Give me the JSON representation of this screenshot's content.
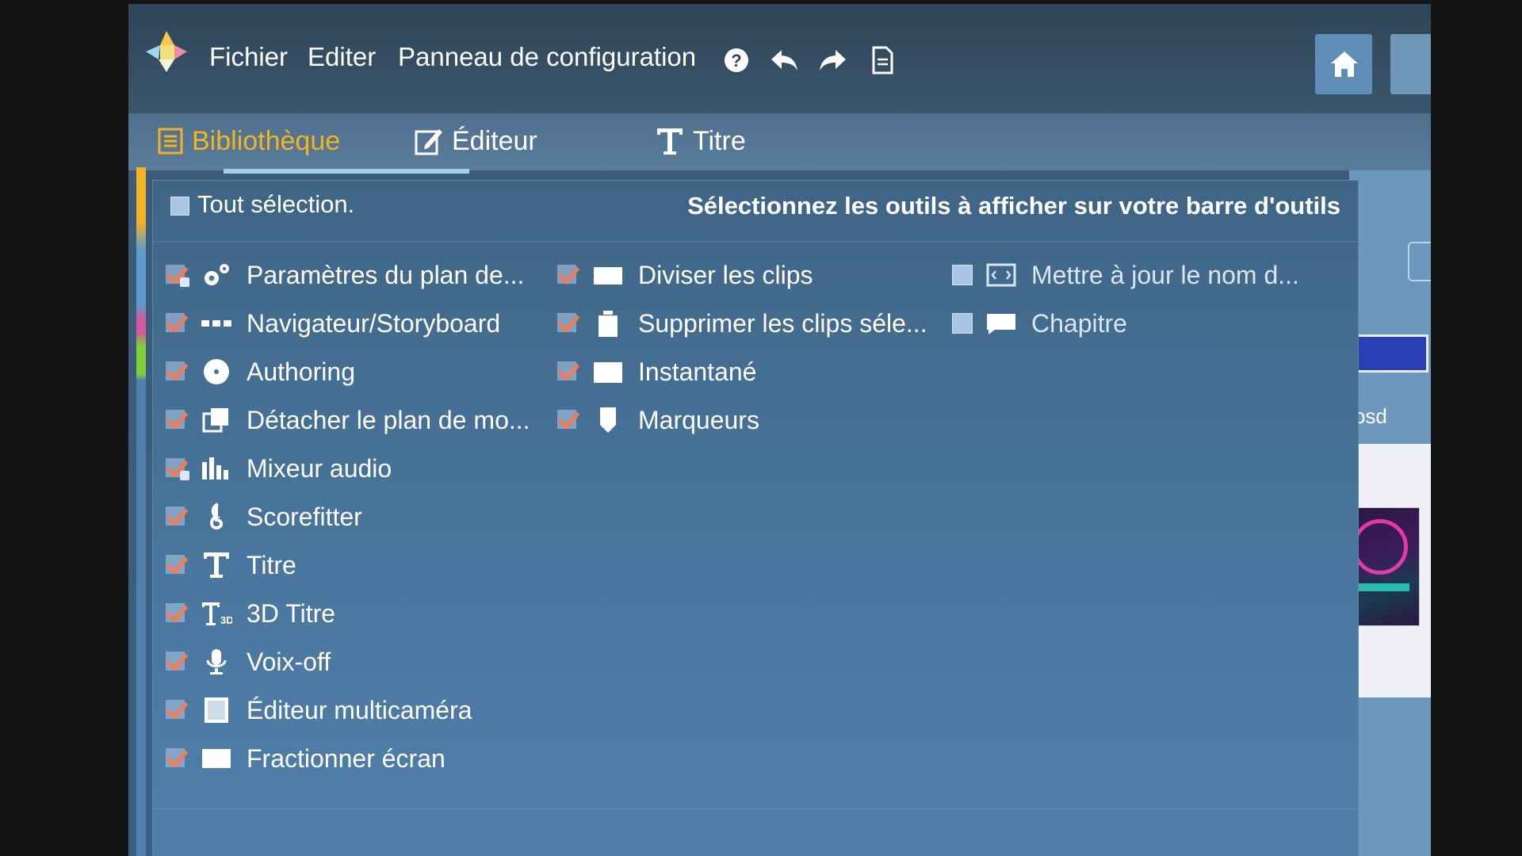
{
  "menubar": {
    "file_label": "Fichier",
    "edit_label": "Editer",
    "control_panel_label": "Panneau de configuration",
    "help_icon": "help-icon",
    "undo_icon": "undo-icon",
    "redo_icon": "redo-icon",
    "notes_icon": "document-icon",
    "home_icon": "home-icon"
  },
  "tabs": [
    {
      "label": "Bibliothèque",
      "icon": "library-icon",
      "active": true
    },
    {
      "label": "Éditeur",
      "icon": "edit-icon",
      "active": false
    },
    {
      "label": "Titre",
      "icon": "title-icon",
      "active": false
    }
  ],
  "dialog": {
    "select_all_label": "Tout sélection.",
    "instruction": "Sélectionnez les outils à afficher sur votre barre d'outils",
    "columns": [
      [
        {
          "label": "Paramètres du plan de...",
          "icon": "gears-icon",
          "checked": true,
          "locked": true
        },
        {
          "label": "Navigateur/Storyboard",
          "icon": "dots-icon",
          "checked": true
        },
        {
          "label": "Authoring",
          "icon": "disc-icon",
          "checked": true
        },
        {
          "label": "Détacher le plan de mo...",
          "icon": "detach-icon",
          "checked": true
        },
        {
          "label": "Mixeur audio",
          "icon": "mixer-icon",
          "checked": true,
          "locked": true
        },
        {
          "label": "Scorefitter",
          "icon": "treble-clef-icon",
          "checked": true
        },
        {
          "label": "Titre",
          "icon": "title-icon",
          "checked": true
        },
        {
          "label": "3D Titre",
          "icon": "title-3d-icon",
          "checked": true
        },
        {
          "label": "Voix-off",
          "icon": "microphone-icon",
          "checked": true
        },
        {
          "label": "Éditeur multicaméra",
          "icon": "multicam-icon",
          "checked": true
        },
        {
          "label": "Fractionner écran",
          "icon": "split-screen-icon",
          "checked": true
        }
      ],
      [
        {
          "label": "Diviser les clips",
          "icon": "split-clip-icon",
          "checked": true
        },
        {
          "label": "Supprimer les clips séle...",
          "icon": "trash-icon",
          "checked": true
        },
        {
          "label": "Instantané",
          "icon": "snapshot-icon",
          "checked": true
        },
        {
          "label": "Marqueurs",
          "icon": "marker-icon",
          "checked": true
        }
      ],
      [
        {
          "label": "Mettre à jour le nom d...",
          "icon": "rename-icon",
          "checked": false
        },
        {
          "label": "Chapitre",
          "icon": "chapter-icon",
          "checked": false
        }
      ]
    ]
  },
  "side_panel": {
    "file_fragment": ").psd"
  },
  "colors": {
    "accent_tab": "#f5b320",
    "checkmark": "#f07c5a",
    "dialog_bg": "#4a77a0"
  }
}
